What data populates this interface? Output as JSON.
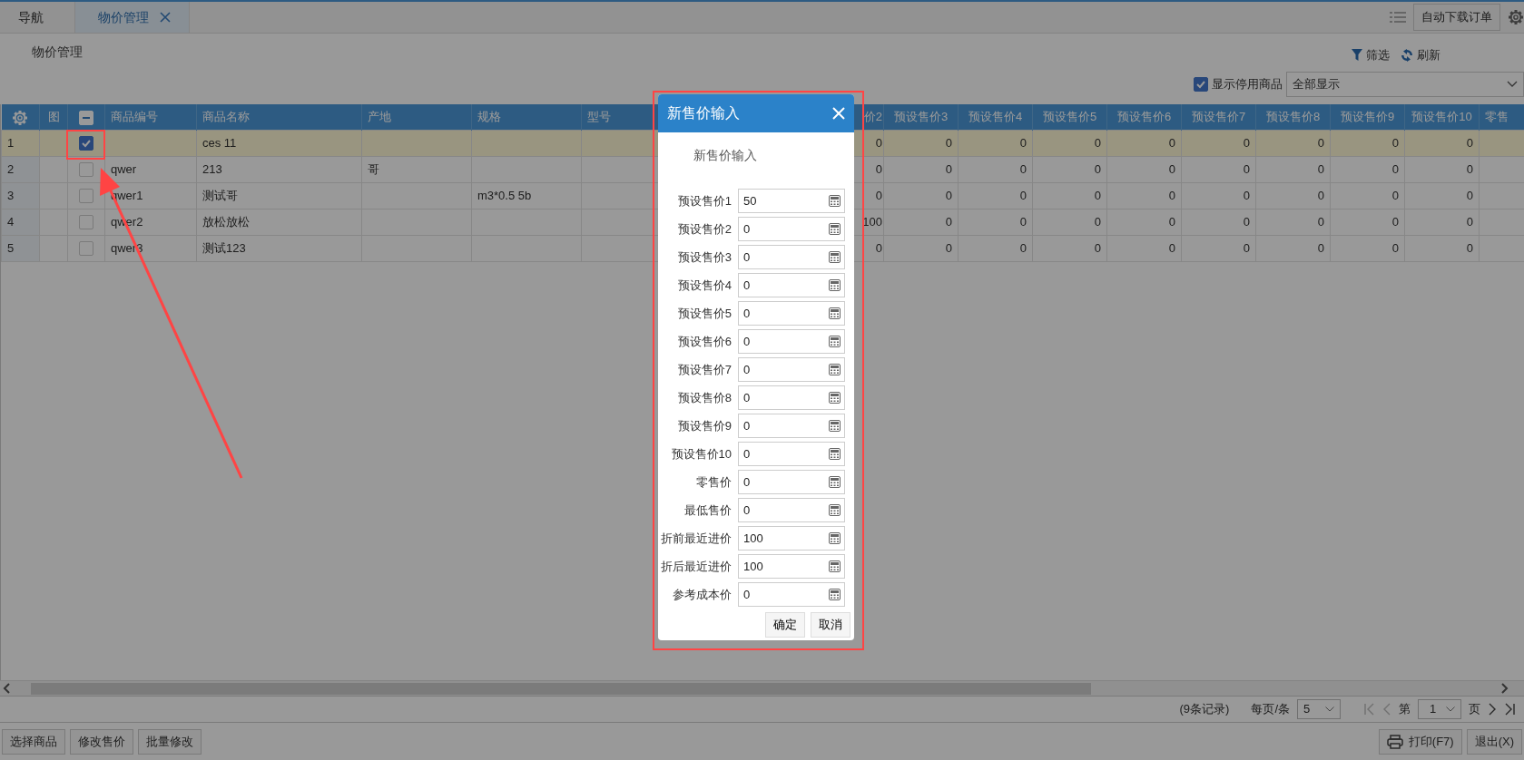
{
  "tabs": [
    {
      "label": "导航",
      "selected": false,
      "closable": false
    },
    {
      "label": "物价管理",
      "selected": true,
      "closable": true
    }
  ],
  "top_right": {
    "button": "自动下载订单"
  },
  "page_title": "物价管理",
  "toolbar": {
    "filter": "筛选",
    "refresh": "刷新"
  },
  "show_disabled": {
    "label": "显示停用商品",
    "checked": true
  },
  "display_select": {
    "value": "全部显示"
  },
  "table": {
    "image_column": "图",
    "header_checkbox": {
      "partial": true
    },
    "columns": [
      "商品编号",
      "商品名称",
      "产地",
      "规格",
      "型号",
      "价2",
      "预设售价3",
      "预设售价4",
      "预设售价5",
      "预设售价6",
      "预设售价7",
      "预设售价8",
      "预设售价9",
      "预设售价10",
      "零售"
    ],
    "rows": [
      {
        "number": "1",
        "selected": true,
        "checked": true,
        "cells": [
          null,
          "ces 11",
          null,
          null,
          null,
          "0",
          "0",
          "0",
          "0",
          "0",
          "0",
          "0",
          "0",
          "0",
          null
        ]
      },
      {
        "number": "2",
        "selected": false,
        "checked": false,
        "cells": [
          "qwer",
          "213",
          "哥",
          null,
          null,
          "0",
          "0",
          "0",
          "0",
          "0",
          "0",
          "0",
          "0",
          "0",
          null
        ]
      },
      {
        "number": "3",
        "selected": false,
        "checked": false,
        "cells": [
          "qwer1",
          "测试哥",
          null,
          "m3*0.5 5b",
          null,
          "0",
          "0",
          "0",
          "0",
          "0",
          "0",
          "0",
          "0",
          "0",
          null
        ]
      },
      {
        "number": "4",
        "selected": false,
        "checked": false,
        "cells": [
          "qwer2",
          "放松放松",
          null,
          null,
          null,
          "100",
          "0",
          "0",
          "0",
          "0",
          "0",
          "0",
          "0",
          "0",
          null
        ]
      },
      {
        "number": "5",
        "selected": false,
        "checked": false,
        "cells": [
          "qwer3",
          "测试123",
          null,
          null,
          null,
          "0",
          "0",
          "0",
          "0",
          "0",
          "0",
          "0",
          "0",
          "0",
          null
        ]
      }
    ]
  },
  "pagination": {
    "records": "(9条记录)",
    "per_page_label": "每页/条",
    "per_page": "5",
    "page_label": "第",
    "page": "1",
    "page_suffix": "页",
    "at_first": true
  },
  "footer_buttons": [
    "选择商品",
    "修改售价",
    "批量修改"
  ],
  "footer_right": [
    {
      "label": "打印(F7)",
      "kind": "print"
    },
    {
      "label": "退出(X)",
      "kind": "plain"
    }
  ],
  "dialog": {
    "title": "新售价输入",
    "subtitle": "新售价输入",
    "fields": [
      {
        "label": "预设售价1",
        "value": "50"
      },
      {
        "label": "预设售价2",
        "value": "0"
      },
      {
        "label": "预设售价3",
        "value": "0"
      },
      {
        "label": "预设售价4",
        "value": "0"
      },
      {
        "label": "预设售价5",
        "value": "0"
      },
      {
        "label": "预设售价6",
        "value": "0"
      },
      {
        "label": "预设售价7",
        "value": "0"
      },
      {
        "label": "预设售价8",
        "value": "0"
      },
      {
        "label": "预设售价9",
        "value": "0"
      },
      {
        "label": "预设售价10",
        "value": "0"
      },
      {
        "label": "零售价",
        "value": "0"
      },
      {
        "label": "最低售价",
        "value": "0"
      },
      {
        "label": "折前最近进价",
        "value": "100"
      },
      {
        "label": "折后最近进价",
        "value": "100"
      },
      {
        "label": "参考成本价",
        "value": "0"
      }
    ],
    "buttons": [
      "确定",
      "取消"
    ]
  }
}
